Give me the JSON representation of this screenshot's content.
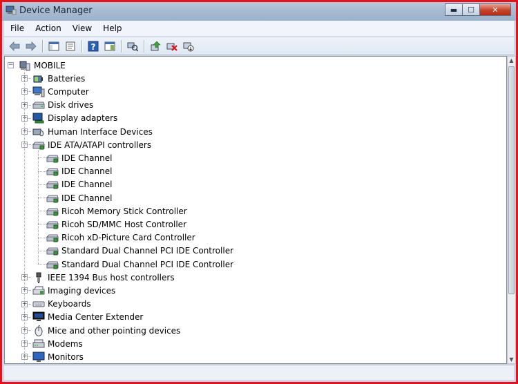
{
  "window": {
    "title": "Device Manager",
    "buttons": {
      "minimize": "▬",
      "maximize": "☐",
      "close": "✕"
    }
  },
  "menu": [
    "File",
    "Action",
    "View",
    "Help"
  ],
  "toolbar": [
    {
      "name": "back-arrow-icon"
    },
    {
      "name": "forward-arrow-icon"
    },
    {
      "name": "show-hide-console-tree-icon"
    },
    {
      "name": "properties-icon"
    },
    {
      "name": "help-icon"
    },
    {
      "name": "show-action-pane-icon"
    },
    {
      "name": "scan-hardware-changes-icon"
    },
    {
      "name": "update-driver-icon"
    },
    {
      "name": "uninstall-icon"
    },
    {
      "name": "disable-device-icon"
    }
  ],
  "tree": {
    "root": "MOBILE",
    "categories": [
      {
        "label": "Batteries",
        "icon": "battery-icon",
        "expanded": false
      },
      {
        "label": "Computer",
        "icon": "computer-icon",
        "expanded": false
      },
      {
        "label": "Disk drives",
        "icon": "disk-drive-icon",
        "expanded": false
      },
      {
        "label": "Display adapters",
        "icon": "display-adapter-icon",
        "expanded": false
      },
      {
        "label": "Human Interface Devices",
        "icon": "hid-icon",
        "expanded": false
      },
      {
        "label": "IDE ATA/ATAPI controllers",
        "icon": "ide-controller-icon",
        "expanded": true,
        "children": [
          "IDE Channel",
          "IDE Channel",
          "IDE Channel",
          "IDE Channel",
          "Ricoh Memory Stick Controller",
          "Ricoh SD/MMC Host Controller",
          "Ricoh xD-Picture Card Controller",
          "Standard Dual Channel PCI IDE Controller",
          "Standard Dual Channel PCI IDE Controller"
        ]
      },
      {
        "label": "IEEE 1394 Bus host controllers",
        "icon": "firewire-icon",
        "expanded": false
      },
      {
        "label": "Imaging devices",
        "icon": "imaging-device-icon",
        "expanded": false
      },
      {
        "label": "Keyboards",
        "icon": "keyboard-icon",
        "expanded": false
      },
      {
        "label": "Media Center Extender",
        "icon": "media-center-icon",
        "expanded": false
      },
      {
        "label": "Mice and other pointing devices",
        "icon": "mouse-icon",
        "expanded": false
      },
      {
        "label": "Modems",
        "icon": "modem-icon",
        "expanded": false
      },
      {
        "label": "Monitors",
        "icon": "monitor-icon",
        "expanded": false
      }
    ]
  },
  "colors": {
    "accent_frame": "#e8111a",
    "titlebar": "#a7bbd2",
    "close_button": "#c8432a"
  }
}
